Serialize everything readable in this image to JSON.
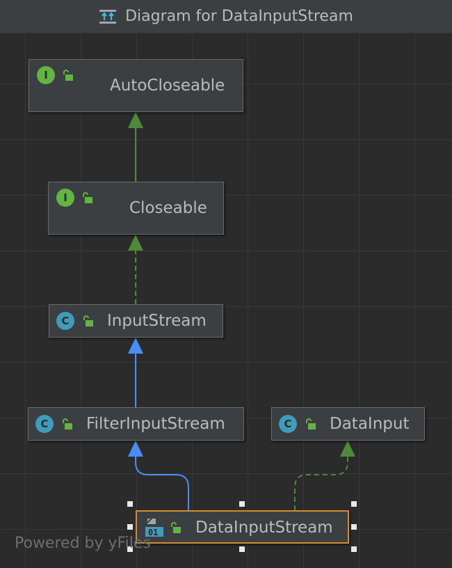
{
  "window": {
    "title": "Diagram for DataInputStream"
  },
  "nodes": {
    "autocloseable": {
      "name": "AutoCloseable",
      "kind": "I"
    },
    "closeable": {
      "name": "Closeable",
      "kind": "I"
    },
    "inputstream": {
      "name": "InputStream",
      "kind": "C"
    },
    "filterinputstream": {
      "name": "FilterInputStream",
      "kind": "C"
    },
    "datainput": {
      "name": "DataInput",
      "kind": "C"
    },
    "datainputstream": {
      "name": "DataInputStream",
      "kind": "01"
    }
  },
  "colors": {
    "interface_badge": "#62b543",
    "class_badge": "#3f9cba",
    "implements_edge": "#4f8a3a",
    "extends_edge": "#4b8ef2",
    "selection_border": "#d38c2f"
  },
  "watermark": "Powered by yFiles"
}
